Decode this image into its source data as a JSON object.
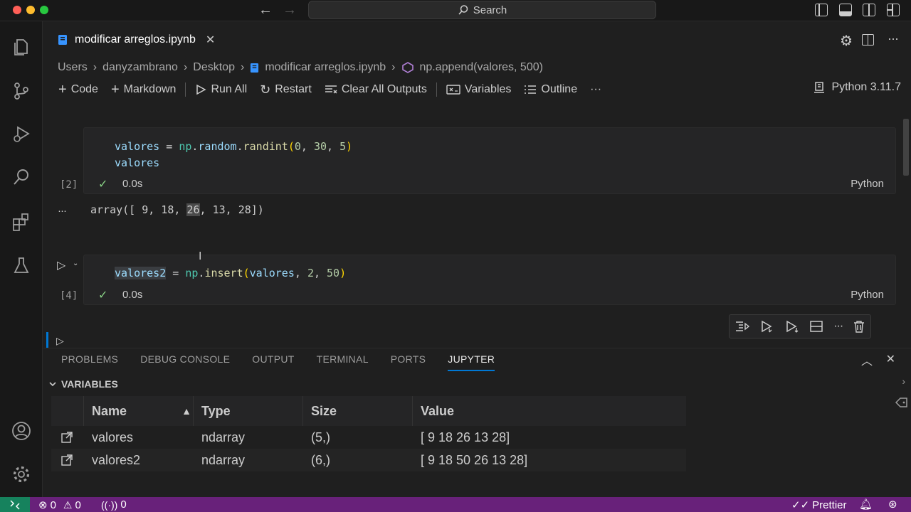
{
  "titlebar": {
    "search_label": "Search"
  },
  "tab": {
    "filename": "modificar arreglos.ipynb",
    "close_glyph": "✕"
  },
  "breadcrumb": [
    "Users",
    "danyzambrano",
    "Desktop",
    "modificar arreglos.ipynb",
    "np.append(valores, 500)"
  ],
  "toolbar": {
    "code": "Code",
    "markdown": "Markdown",
    "run_all": "Run All",
    "restart": "Restart",
    "clear_outputs": "Clear All Outputs",
    "variables": "Variables",
    "outline": "Outline",
    "more": "···",
    "kernel": "Python 3.11.7"
  },
  "cells": [
    {
      "exec_count": "[2]",
      "duration": "0.0s",
      "language": "Python",
      "output_more": "···",
      "output_parts": [
        "array([ 9, 18, ",
        "26",
        ", 13, 28])"
      ]
    },
    {
      "exec_count": "[4]",
      "duration": "0.0s",
      "language": "Python"
    }
  ],
  "panel": {
    "tabs": [
      "PROBLEMS",
      "DEBUG CONSOLE",
      "OUTPUT",
      "TERMINAL",
      "PORTS",
      "JUPYTER"
    ],
    "active_tab": "JUPYTER",
    "section_title": "VARIABLES",
    "columns": [
      "Name",
      "Type",
      "Size",
      "Value"
    ],
    "sort_glyph": "▲",
    "rows": [
      {
        "name": "valores",
        "type": "ndarray",
        "size": "(5,)",
        "value": "[ 9 18 26 13 28]"
      },
      {
        "name": "valores2",
        "type": "ndarray",
        "size": "(6,)",
        "value": "[ 9 18 50 26 13 28]"
      }
    ]
  },
  "statusbar": {
    "errors": "0",
    "warnings": "0",
    "ports": "0",
    "prettier": "Prettier"
  },
  "colors": {
    "status_bar": "#68217a",
    "remote": "#16825d",
    "accent": "#0078d4"
  }
}
